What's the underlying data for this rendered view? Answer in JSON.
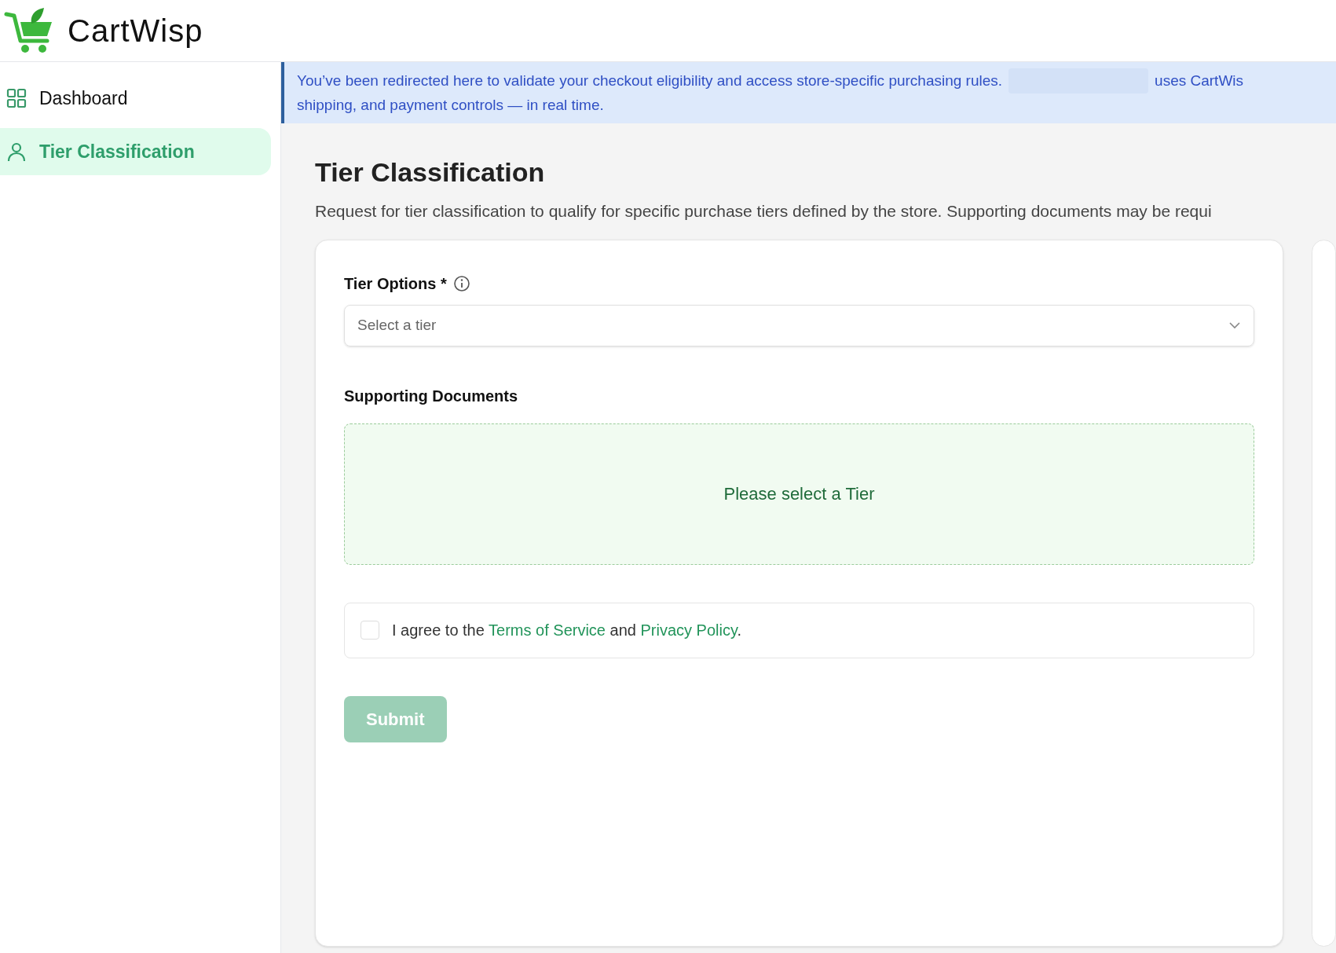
{
  "header": {
    "logo_text": "CartWisp"
  },
  "sidebar": {
    "items": [
      {
        "label": "Dashboard",
        "kind": "grid",
        "selected": false
      },
      {
        "label": "Tier Classification",
        "kind": "person",
        "selected": true
      }
    ]
  },
  "banner": {
    "line_1_start": "You’ve been redirected here to validate your checkout eligibility and access store-specific purchasing rules.",
    "line_1_end": "uses CartWis",
    "line_2": "shipping, and payment controls — in real time."
  },
  "page": {
    "title": "Tier Classification",
    "subtitle": "Request for tier classification to qualify for specific purchase tiers defined by the store. Supporting documents may be requi"
  },
  "form": {
    "tier_field": {
      "label": "Tier Options *",
      "placeholder": "Select a tier"
    },
    "documents": {
      "label": "Supporting Documents",
      "message": "Please select a Tier"
    },
    "agreement": {
      "checked": false,
      "segments": [
        {
          "kind": "text",
          "text": "I agree to the "
        },
        {
          "kind": "link",
          "text": "Terms of Service"
        },
        {
          "kind": "text",
          "text": " and "
        },
        {
          "kind": "link",
          "text": "Privacy Policy"
        },
        {
          "kind": "text",
          "text": "."
        }
      ]
    },
    "submit": {
      "label": "Submit",
      "disabled": true
    }
  }
}
